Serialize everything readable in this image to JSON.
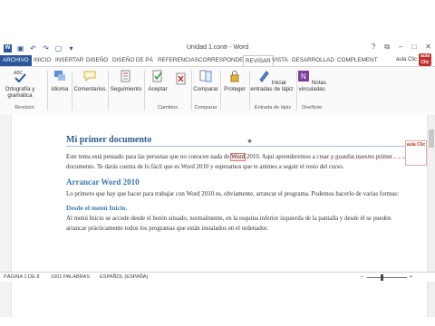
{
  "window": {
    "title": "Unidad 1.contr - Word",
    "min_glyph": "–",
    "max_glyph": "□",
    "close_glyph": "✕",
    "help_glyph": "?",
    "restore_glyph": "⧉"
  },
  "qat": {
    "logo_text": "W",
    "save_glyph": "▣",
    "undo_glyph": "↶",
    "redo_glyph": "↷",
    "new_glyph": "▢",
    "more_glyph": "▾"
  },
  "tabs": [
    "ARCHIVO",
    "INICIO",
    "INSERTAR",
    "DISEÑO",
    "DISEÑO DE PÁ",
    "REFERENCIAS",
    "CORRESPONDE",
    "REVISAR",
    "VISTA",
    "DESARROLLAD",
    "COMPLEMENT"
  ],
  "account": {
    "name": "aula Clic",
    "logo_text": "aula Clic"
  },
  "ribbon": {
    "spelling": "Ortografía y gramática",
    "spelling_icon_label": "ABC",
    "language": "Idioma",
    "comments": "Comentarios",
    "tracking": "Seguimiento",
    "accept": "Aceptar",
    "compare": "Comparar",
    "protect": "Proteger",
    "ink": "Iniciar entradas de lápiz",
    "onenote": "Notas vinculadas",
    "groups": {
      "revision": "Revisión",
      "changes": "Cambios",
      "compare": "Comparar",
      "ink": "Entrada de lápiz",
      "onenote": "OneNote"
    }
  },
  "document": {
    "h1": "Mi primer documento",
    "p1_before": "Este tema está pensado para las personas que no conocen nada de ",
    "p1_highlight": "Word",
    "p1_after": " 2010. Aquí aprenderemos a crear y guardar nuestro primer documento. Te darás cuenta de lo fácil que es Word 2010 y esperamos que te animes a seguir el resto del curso.",
    "h2": "Arrancar Word 2010",
    "p2": "Lo primero que hay que hacer para trabajar con Word 2010 es, obviamente, arrancar el programa. Podemos hacerlo de varias formas:",
    "h3": "Desde el menú Inicio.",
    "p3": "Al menú Inicio se accede desde el botón situado, normalmente, en la esquina inferior izquierda de la pantalla y desde él se pueden arrancar prácticamente todos los programas que están instalados en el ordenador.",
    "rev_logo_text": "aula Clic"
  },
  "status": {
    "page": "PÁGINA 1 DE 8",
    "words": "1501 PALABRAS",
    "language": "ESPAÑOL (ESPAÑA)",
    "zoom_minus": "–",
    "zoom_plus": "+"
  },
  "colors": {
    "accent": "#2b579a",
    "brand_red": "#c0302b",
    "heading": "#2e5b8c"
  }
}
